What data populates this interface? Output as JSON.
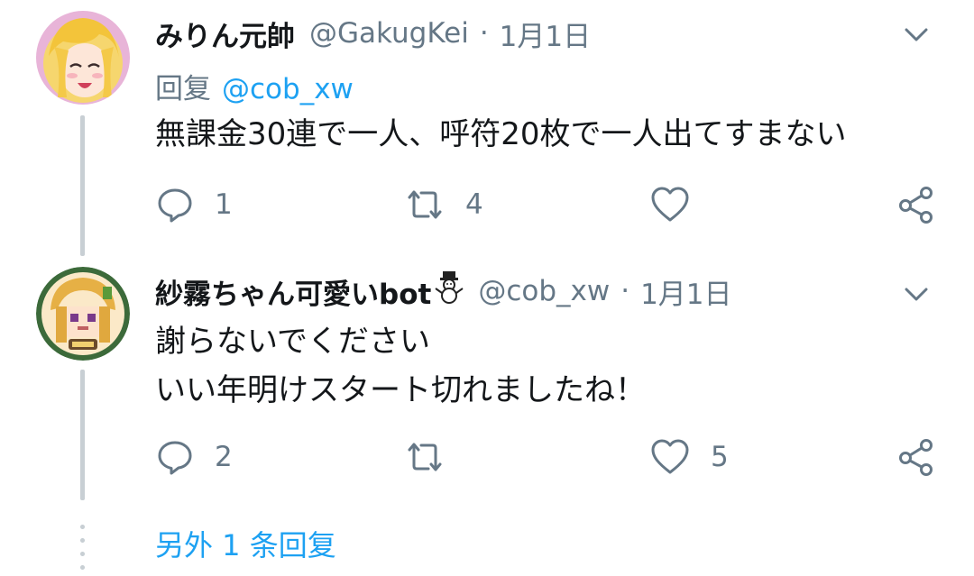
{
  "tweets": [
    {
      "display_name": "みりん元帥",
      "handle": "@GakugKei",
      "separator": "·",
      "date": "1月1日",
      "reply_label": "回复",
      "reply_mention": "@cob_xw",
      "text_lines": [
        "無課金30連で一人、呼符20枚で一人出てすまない"
      ],
      "replies": "1",
      "retweets": "4",
      "likes": "",
      "icons": [
        "reply-icon",
        "retweet-icon",
        "like-icon",
        "share-icon",
        "chevron-down-icon"
      ]
    },
    {
      "display_name": "紗霧ちゃん可愛いbot",
      "name_emoji": "snowman",
      "handle": "@cob_xw",
      "separator": "·",
      "date": "1月1日",
      "text_lines": [
        "謝らないでください",
        "いい年明けスタート切れましたね！"
      ],
      "replies": "2",
      "retweets": "",
      "likes": "5",
      "icons": [
        "reply-icon",
        "retweet-icon",
        "like-icon",
        "share-icon",
        "chevron-down-icon"
      ]
    }
  ],
  "more_replies": "另外 1 条回复",
  "colors": {
    "text": "#14171a",
    "secondary": "#657786",
    "link": "#1da1f2",
    "thread_line": "#c8cfd4"
  }
}
